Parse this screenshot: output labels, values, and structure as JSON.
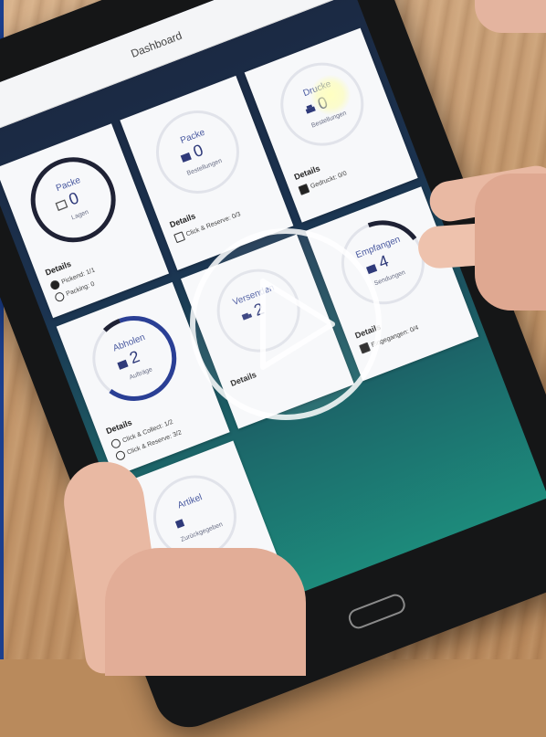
{
  "app": {
    "title": "Dashboard",
    "gear_icon": "settings-gear-icon"
  },
  "cards": [
    {
      "id": "packe-lagen",
      "label": "Packe",
      "count": "0",
      "sub": "Lagen",
      "icon": "box-icon",
      "ring_progress": 1.0,
      "details_label": "Details",
      "details": [
        {
          "icon": "check-circle-icon",
          "text": "Pickend: 1/1"
        },
        {
          "icon": "check-circle-outline-icon",
          "text": "Packing: 0"
        }
      ]
    },
    {
      "id": "packe-bestellungen",
      "label": "Packe",
      "count": "0",
      "sub": "Bestellungen",
      "icon": "box-icon",
      "ring_progress": 0,
      "details_label": "Details",
      "details": [
        {
          "icon": "box-outline-icon",
          "text": "Click & Reserve: 0/3"
        }
      ]
    },
    {
      "id": "drucke",
      "label": "Drucke",
      "count": "0",
      "sub": "Bestellungen",
      "icon": "print-icon",
      "ring_progress": 0,
      "details_label": "Details",
      "details": [
        {
          "icon": "print-icon",
          "text": "Gedruckt: 0/0"
        }
      ]
    },
    {
      "id": "abholen",
      "label": "Abholen",
      "count": "2",
      "sub": "Aufträge",
      "icon": "bag-icon",
      "ring_progress": 0.55,
      "details_label": "Details",
      "details": [
        {
          "icon": "user-outline-icon",
          "text": "Click & Collect: 1/2"
        },
        {
          "icon": "user-outline-icon",
          "text": "Click & Reserve: 3/2"
        }
      ]
    },
    {
      "id": "versenden",
      "label": "Versenden",
      "count": "2",
      "sub": "",
      "icon": "truck-icon",
      "ring_progress": 0,
      "details_label": "Details",
      "details": []
    },
    {
      "id": "empfangen",
      "label": "Empfangen",
      "count": "4",
      "sub": "Sendungen",
      "icon": "box-icon",
      "ring_progress": 0.3,
      "details_label": "Details",
      "details": [
        {
          "icon": "box-filled-icon",
          "text": "Eingegangen: 0/4"
        }
      ]
    },
    {
      "id": "artikel",
      "label": "Artikel",
      "count": "",
      "sub": "Zurückgegeben",
      "icon": "tag-icon",
      "ring_progress": 0,
      "details_label": "",
      "details": []
    }
  ],
  "colors": {
    "screen_bg": "#1b2740",
    "card_bg": "#f7f8fa",
    "ring_dark": "#1f2235",
    "ring_blue": "#2a3f95",
    "accent_text": "#4a5aa0"
  },
  "overlay": {
    "icon": "play-button-icon"
  }
}
